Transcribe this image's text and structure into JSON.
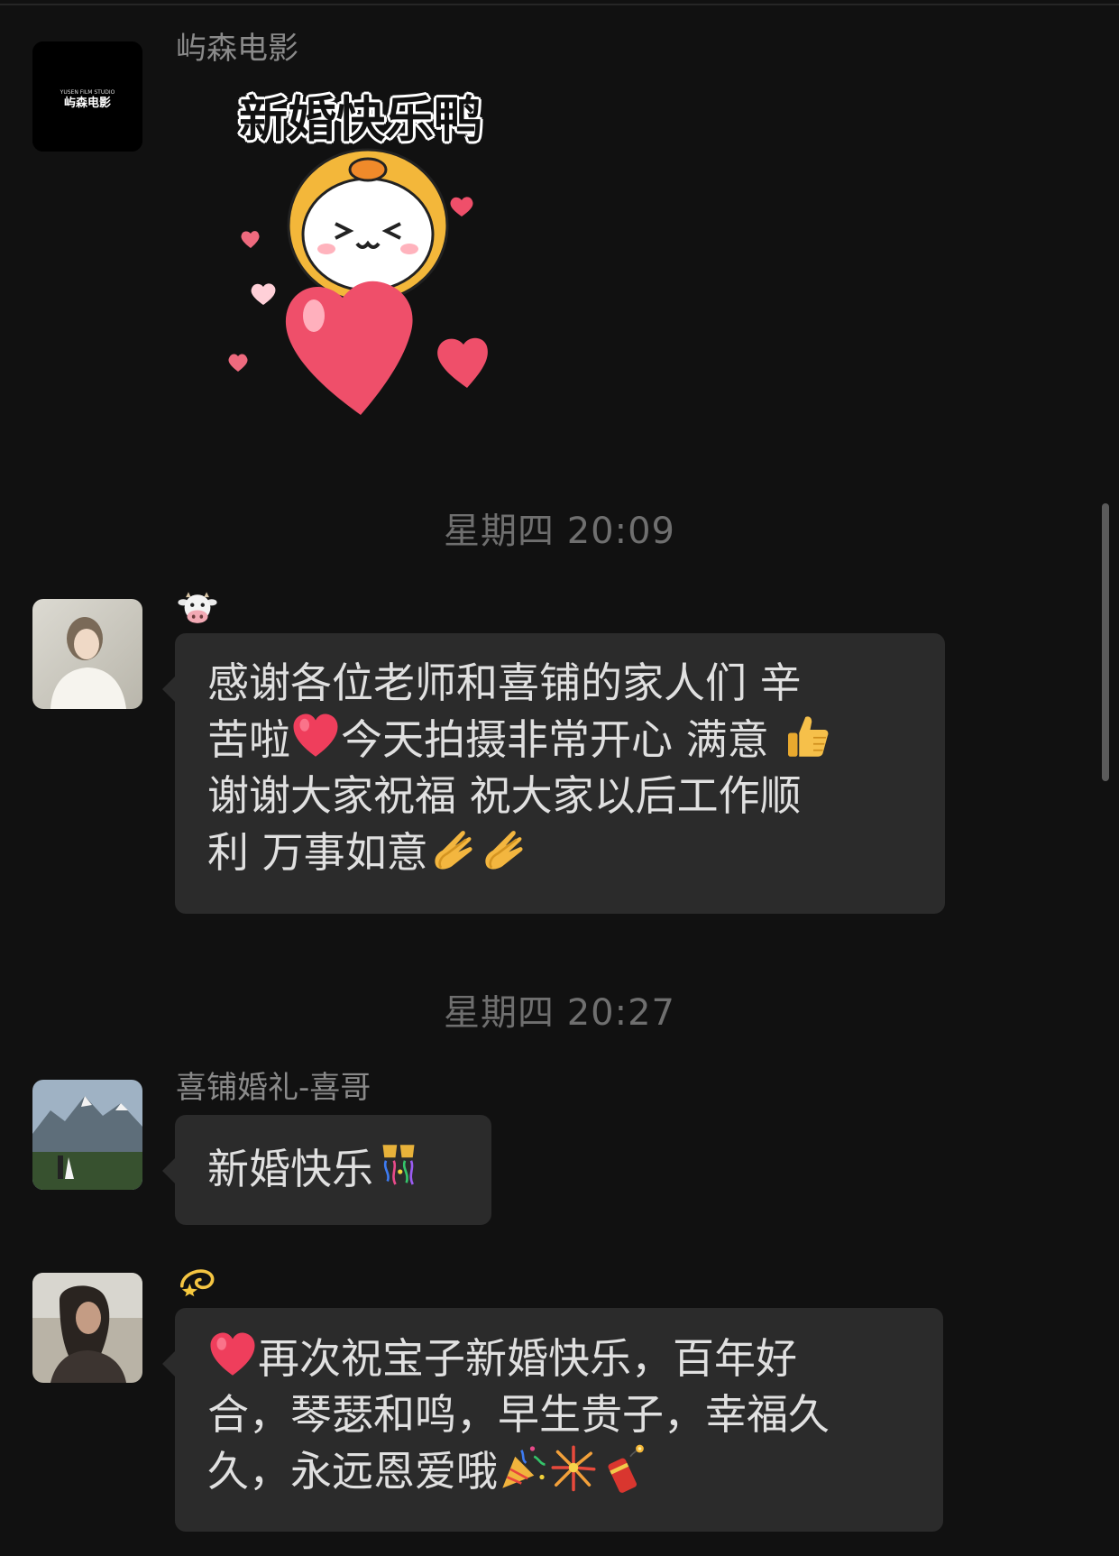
{
  "messages": [
    {
      "sender": "屿森电影",
      "avatar_logo_small": "YUSEN FILM STUDIO",
      "avatar_logo_main": "屿森电影",
      "sticker_caption": "新婚快乐鸭"
    },
    {
      "timestamp": "星期四 20:09"
    },
    {
      "sender_emoji": "cow-face",
      "lines": [
        "感谢各位老师和喜铺的家人们 辛",
        "苦啦",
        "今天拍摄非常开心 满意 ",
        "谢谢大家祝福 祝大家以后工作顺",
        "利 万事如意"
      ]
    },
    {
      "timestamp": "星期四 20:27"
    },
    {
      "sender": "喜铺婚礼-喜哥",
      "text": "新婚快乐"
    },
    {
      "sender_emoji": "dizzy",
      "lines": [
        "再次祝宝子新婚快乐，百年好",
        "合，琴瑟和鸣，早生贵子，幸福久",
        "久，永远恩爱哦"
      ]
    }
  ],
  "icons": {
    "heart": "red-heart-icon",
    "thumbs_up": "thumbs-up-icon",
    "clap": "clapping-hands-icon",
    "confetti": "confetti-ball-icon",
    "party": "party-popper-icon",
    "fireworks": "fireworks-icon",
    "firecracker": "firecracker-icon"
  },
  "colors": {
    "background": "#111111",
    "bubble": "#2b2b2b",
    "timestamp": "#6f6f6f",
    "sender": "#8a8a8a"
  }
}
